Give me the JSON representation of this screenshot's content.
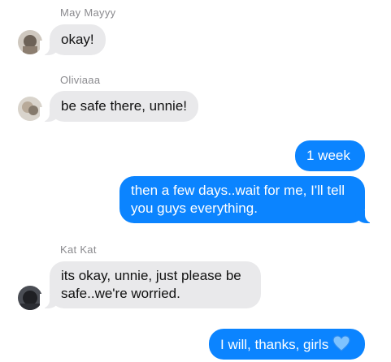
{
  "messages": [
    {
      "sender": "May Mayyy",
      "text": "okay!",
      "avatar": "avatar-photo-icon"
    },
    {
      "sender": "Oliviaaa",
      "text": "be safe there, unnie!",
      "avatar": "avatar-photo-icon"
    },
    {
      "text": "1 week"
    },
    {
      "line1": "then a few days..wait for me, I'll tell",
      "line2": "you guys everything."
    },
    {
      "sender": "Kat Kat",
      "line1": "its okay, unnie, just please be",
      "line2": "safe..we're worried.",
      "avatar": "avatar-photo-icon"
    },
    {
      "text": "I will, thanks, girls",
      "emoji": "blue-heart-icon"
    }
  ],
  "colors": {
    "incoming_bubble": "#e9e9eb",
    "outgoing_bubble": "#0b84ff",
    "sender_name": "#8a8a8e"
  }
}
